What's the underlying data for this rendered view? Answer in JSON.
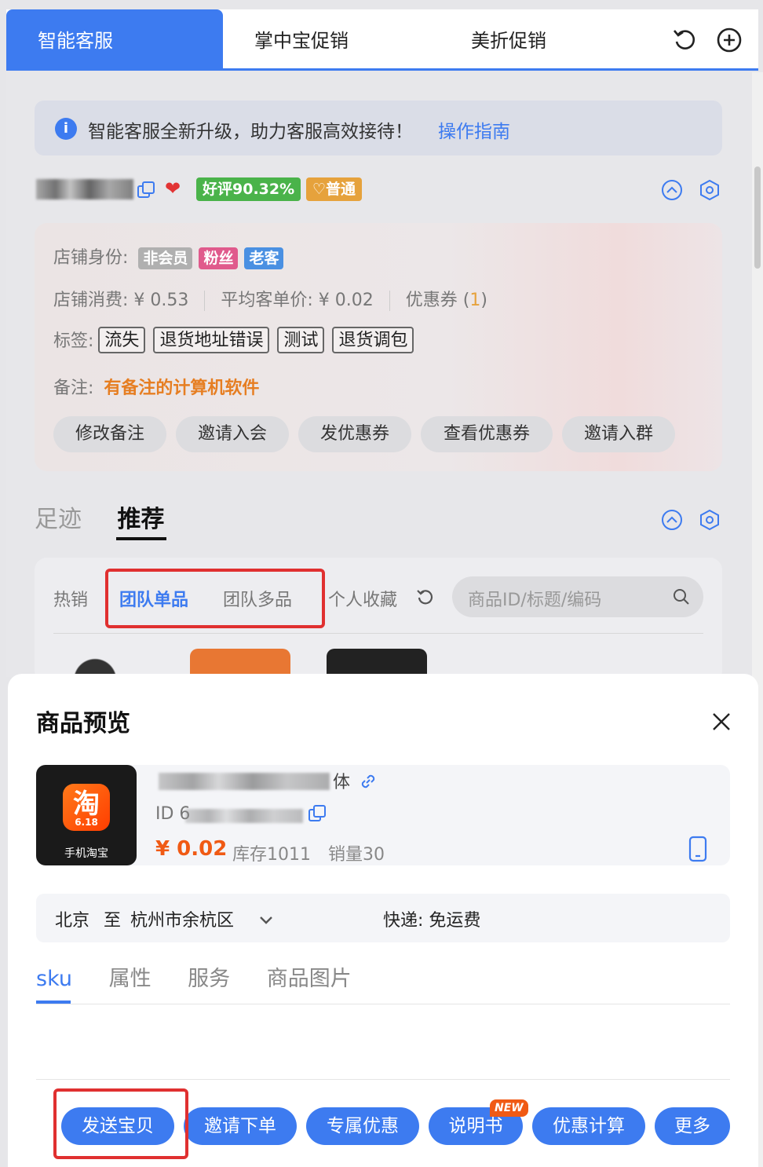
{
  "tabs": [
    {
      "label": "智能客服",
      "active": true
    },
    {
      "label": "掌中宝促销",
      "active": false
    },
    {
      "label": "美折促销",
      "active": false
    }
  ],
  "notice": {
    "text": "智能客服全新升级，助力客服高效接待！",
    "link": "操作指南"
  },
  "customer": {
    "rating_badge": "好评90.32%",
    "level_badge": "普通",
    "identity_label": "店铺身份:",
    "identity_tags": [
      "非会员",
      "粉丝",
      "老客"
    ],
    "spend_label": "店铺消费: ¥ 0.53",
    "avg_label": "平均客单价: ¥ 0.02",
    "coupon_label": "优惠券 (",
    "coupon_count": "1",
    "coupon_close": ")",
    "tags_label": "标签:",
    "tags": [
      "流失",
      "退货地址错误",
      "测试",
      "退货调包"
    ],
    "remark_label": "备注:",
    "remark": "有备注的计算机软件",
    "actions": [
      "修改备注",
      "邀请入会",
      "发优惠券",
      "查看优惠券",
      "邀请入群"
    ]
  },
  "section_tabs": [
    {
      "label": "足迹",
      "active": false
    },
    {
      "label": "推荐",
      "active": true
    }
  ],
  "recommend": {
    "filters": [
      "热销",
      "团队单品",
      "团队多品",
      "个人收藏"
    ],
    "active_filter": "团队单品",
    "search_placeholder": "商品ID/标题/编码"
  },
  "preview": {
    "title": "商品预览",
    "product": {
      "name_tail": "体",
      "id_prefix": "ID 6",
      "price": "¥ 0.02",
      "stock": "库存1011",
      "sales": "销量30",
      "image_label": "手机淘宝",
      "logo_text": "淘",
      "logo_sub": "6.18"
    },
    "shipping": {
      "from": "北京",
      "to_word": "至",
      "dest": "杭州市余杭区",
      "method": "快递: 免运费"
    },
    "tabs": [
      {
        "label": "sku",
        "active": true
      },
      {
        "label": "属性",
        "active": false
      },
      {
        "label": "服务",
        "active": false
      },
      {
        "label": "商品图片",
        "active": false
      }
    ],
    "buttons": [
      "发送宝贝",
      "邀请下单",
      "专属优惠",
      "说明书",
      "优惠计算",
      "更多"
    ],
    "new_badge": "NEW"
  },
  "colors": {
    "accent": "#3d7bf0",
    "price": "#f05a14",
    "highlight": "#e03030"
  }
}
